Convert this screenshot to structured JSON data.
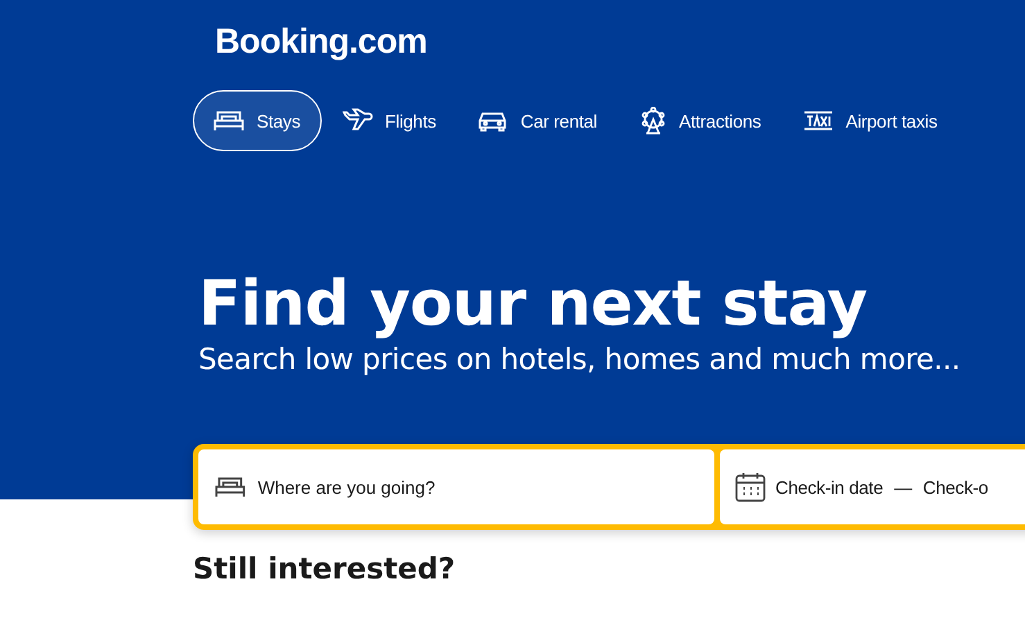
{
  "header": {
    "logo": "Booking.com"
  },
  "tabs": [
    {
      "label": "Stays",
      "selected": true
    },
    {
      "label": "Flights",
      "selected": false
    },
    {
      "label": "Car rental",
      "selected": false
    },
    {
      "label": "Attractions",
      "selected": false
    },
    {
      "label": "Airport taxis",
      "selected": false
    }
  ],
  "hero": {
    "title": "Find your next stay",
    "subtitle": "Search low prices on hotels, homes and much more..."
  },
  "search": {
    "destination_placeholder": "Where are you going?",
    "check_in": "Check-in date",
    "separator": "—",
    "check_out": "Check-o"
  },
  "section": {
    "title": "Still interested?"
  }
}
